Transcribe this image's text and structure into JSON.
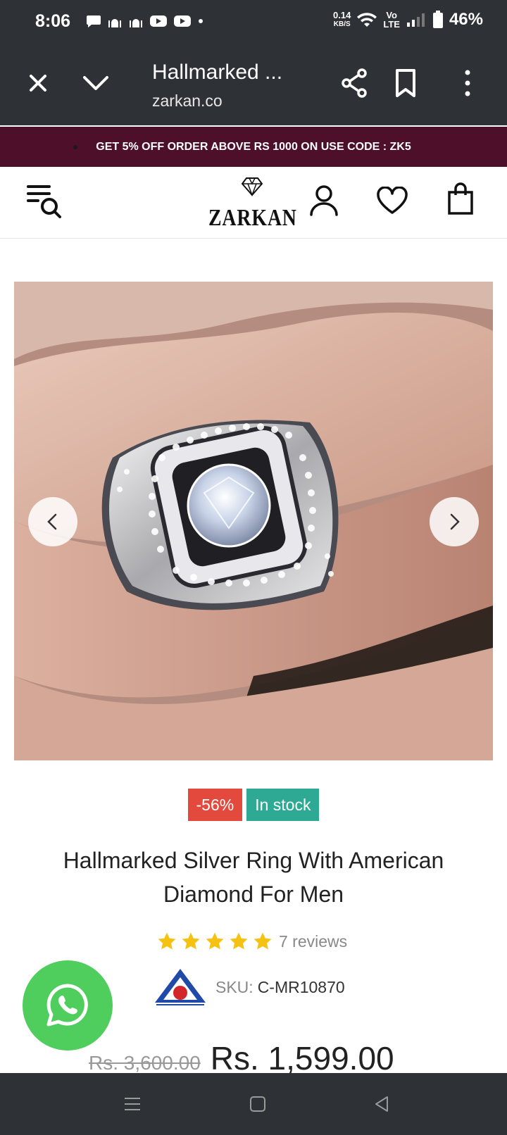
{
  "status_bar": {
    "time": "8:06",
    "net_speed_value": "0.14",
    "net_speed_unit": "KB/S",
    "volte_top": "Vo",
    "volte_bottom": "LTE",
    "battery": "46%"
  },
  "browser": {
    "page_title": "Hallmarked ...",
    "url": "zarkan.co"
  },
  "promo": {
    "text": "GET 5% OFF ORDER ABOVE RS 1000 ON USE CODE : ZK5"
  },
  "header": {
    "logo": "ZARKAN"
  },
  "product": {
    "discount_badge": "-56%",
    "stock_badge": "In stock",
    "title": "Hallmarked Silver Ring With American Diamond For Men",
    "rating": 5,
    "reviews": "7 reviews",
    "sku_label": "SKU:",
    "sku_value": "C-MR10870",
    "price_old": "Rs. 3,600.00",
    "price_new": "Rs. 1,599.00"
  },
  "colors": {
    "promo_bg": "#4e0f2b",
    "sale_badge": "#e34a3d",
    "stock_badge": "#2eaa94",
    "star": "#f6c211",
    "whatsapp": "#4fce5d",
    "system_bar": "#2e3135"
  },
  "icons": [
    "close-icon",
    "chevron-down-icon",
    "share-icon",
    "bookmark-icon",
    "more-vert-icon",
    "menu-search-icon",
    "user-icon",
    "heart-icon",
    "bag-icon",
    "chevron-left-icon",
    "chevron-right-icon",
    "star-icon",
    "whatsapp-icon",
    "bis-hallmark-logo",
    "nav-menu-icon",
    "nav-home-icon",
    "nav-back-icon"
  ]
}
